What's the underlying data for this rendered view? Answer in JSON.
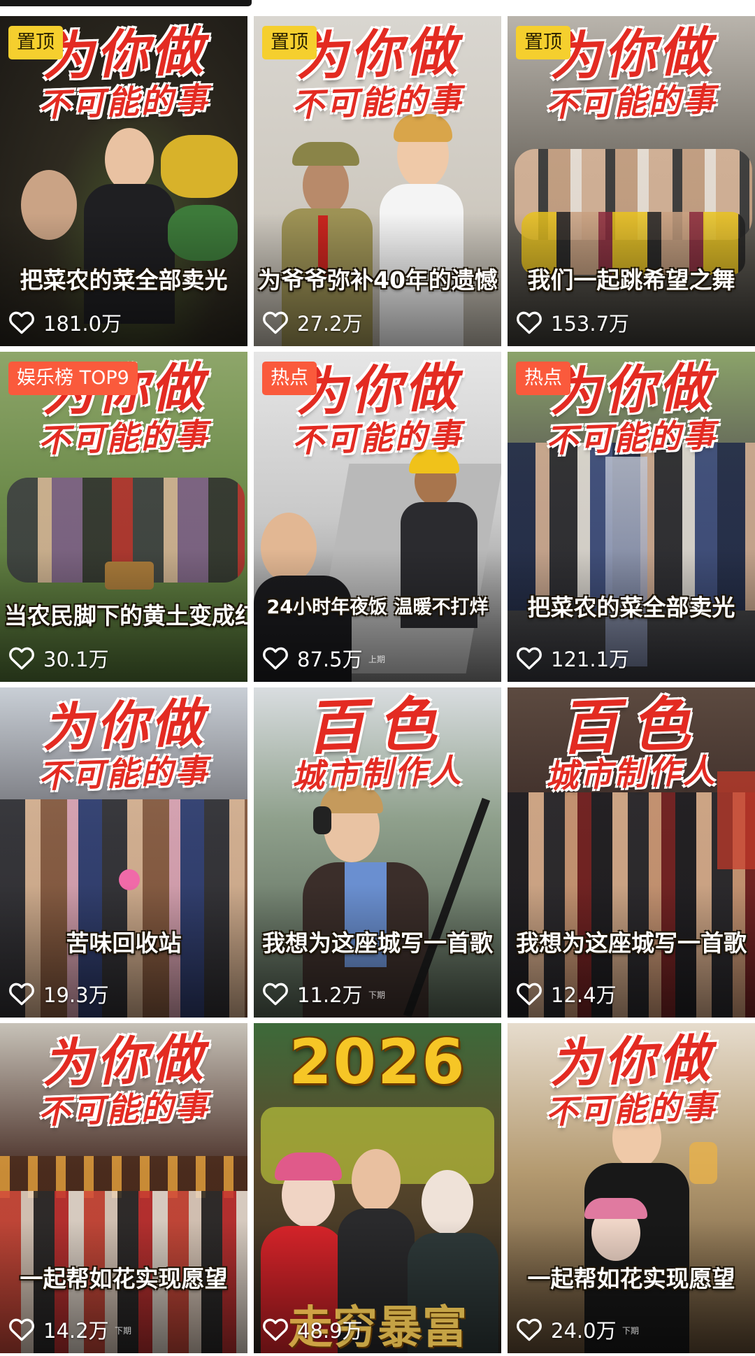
{
  "colors": {
    "title_red": "#e32b22",
    "pinned_badge": "#f5cf2e",
    "hot_badge": "#fa5a3c",
    "caption_text": "#ffffff"
  },
  "cards": [
    {
      "title_line1": "为你做",
      "title_line2": "不可能的事",
      "badge": "置顶",
      "badge_type": "pinned",
      "caption": "把菜农的菜全部卖光",
      "likes": "181.0万",
      "ep_mark": "",
      "like_icon": "heart-outline-icon"
    },
    {
      "title_line1": "为你做",
      "title_line2": "不可能的事",
      "badge": "置顶",
      "badge_type": "pinned",
      "caption": "为爷爷弥补40年的遗憾",
      "likes": "27.2万",
      "ep_mark": "",
      "like_icon": "heart-outline-icon"
    },
    {
      "title_line1": "为你做",
      "title_line2": "不可能的事",
      "badge": "置顶",
      "badge_type": "pinned",
      "caption": "我们一起跳希望之舞",
      "likes": "153.7万",
      "ep_mark": "",
      "like_icon": "heart-outline-icon"
    },
    {
      "title_line1": "为你做",
      "title_line2": "不可能的事",
      "badge": "娱乐榜 TOP9",
      "badge_type": "hot",
      "caption": "当农民脚下的黄土变成红毯",
      "likes": "30.1万",
      "ep_mark": "",
      "like_icon": "heart-outline-icon"
    },
    {
      "title_line1": "为你做",
      "title_line2": "不可能的事",
      "badge": "热点",
      "badge_type": "hot",
      "caption": "24小时年夜饭 温暖不打烊",
      "likes": "87.5万",
      "ep_mark": "上期",
      "like_icon": "heart-outline-icon"
    },
    {
      "title_line1": "为你做",
      "title_line2": "不可能的事",
      "badge": "热点",
      "badge_type": "hot",
      "caption": "把菜农的菜全部卖光",
      "likes": "121.1万",
      "ep_mark": "",
      "like_icon": "heart-outline-icon"
    },
    {
      "title_line1": "为你做",
      "title_line2": "不可能的事",
      "badge": "",
      "badge_type": "",
      "caption": "苦味回收站",
      "likes": "19.3万",
      "ep_mark": "",
      "like_icon": "heart-outline-icon"
    },
    {
      "title_line1": "百色",
      "title_line2": "城市制作人",
      "badge": "",
      "badge_type": "",
      "caption": "我想为这座城写一首歌",
      "likes": "11.2万",
      "ep_mark": "下期",
      "like_icon": "heart-outline-icon"
    },
    {
      "title_line1": "百色",
      "title_line2": "城市制作人",
      "badge": "",
      "badge_type": "",
      "caption": "我想为这座城写一首歌",
      "likes": "12.4万",
      "ep_mark": "",
      "like_icon": "heart-outline-icon"
    },
    {
      "title_line1": "为你做",
      "title_line2": "不可能的事",
      "badge": "",
      "badge_type": "",
      "caption": "一起帮如花实现愿望",
      "likes": "14.2万",
      "ep_mark": "下期",
      "like_icon": "heart-outline-icon"
    },
    {
      "title_line1": "2026",
      "title_line2": "",
      "badge": "",
      "badge_type": "",
      "caption": "",
      "bottom_text": "走穷暴富",
      "likes": "48.9万",
      "ep_mark": "",
      "like_icon": "heart-outline-icon"
    },
    {
      "title_line1": "为你做",
      "title_line2": "不可能的事",
      "badge": "",
      "badge_type": "",
      "caption": "一起帮如花实现愿望",
      "likes": "24.0万",
      "ep_mark": "下期",
      "like_icon": "heart-outline-icon"
    }
  ]
}
